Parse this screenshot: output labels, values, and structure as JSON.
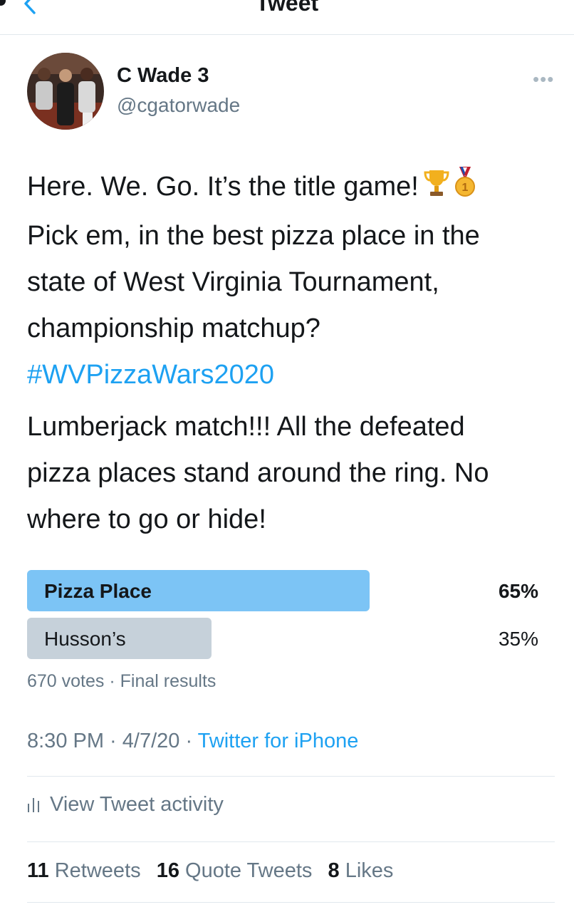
{
  "header": {
    "title": "Tweet"
  },
  "author": {
    "name": "C Wade 3",
    "handle": "@cgatorwade"
  },
  "tweet": {
    "line1": "Here. We. Go. It’s the title game!",
    "line2": "Pick em, in the best pizza place in the",
    "line3": "state of West Virginia Tournament,",
    "line4": "championship matchup?",
    "hashtag": "#WVPizzaWars2020",
    "para2_line1": "Lumberjack match!!! All the defeated",
    "para2_line2": "pizza places stand around the ring. No",
    "para2_line3": "where to go or hide!"
  },
  "poll": {
    "options": [
      {
        "label": "Pizza Place",
        "percent": "65%",
        "fraction": 0.65,
        "color": "#7cc4f5"
      },
      {
        "label": "Husson’s",
        "percent": "35%",
        "fraction": 0.35,
        "color": "#c6d1da"
      }
    ],
    "votes": "670 votes",
    "status": "Final results"
  },
  "meta": {
    "time": "8:30 PM",
    "date": "4/7/20",
    "source": "Twitter for iPhone"
  },
  "activity": {
    "label": "View Tweet activity"
  },
  "stats": {
    "retweets": "11",
    "retweets_label": "Retweets",
    "quotes": "16",
    "quotes_label": "Quote Tweets",
    "likes": "8",
    "likes_label": "Likes"
  },
  "icons": [
    "back-chevron-icon",
    "more-options-icon",
    "trophy-emoji-icon",
    "medal-emoji-icon",
    "activity-bars-icon"
  ],
  "colors": {
    "link": "#1da1f2",
    "muted": "#657786",
    "winner_bar": "#7cc4f5",
    "loser_bar": "#c6d1da"
  }
}
